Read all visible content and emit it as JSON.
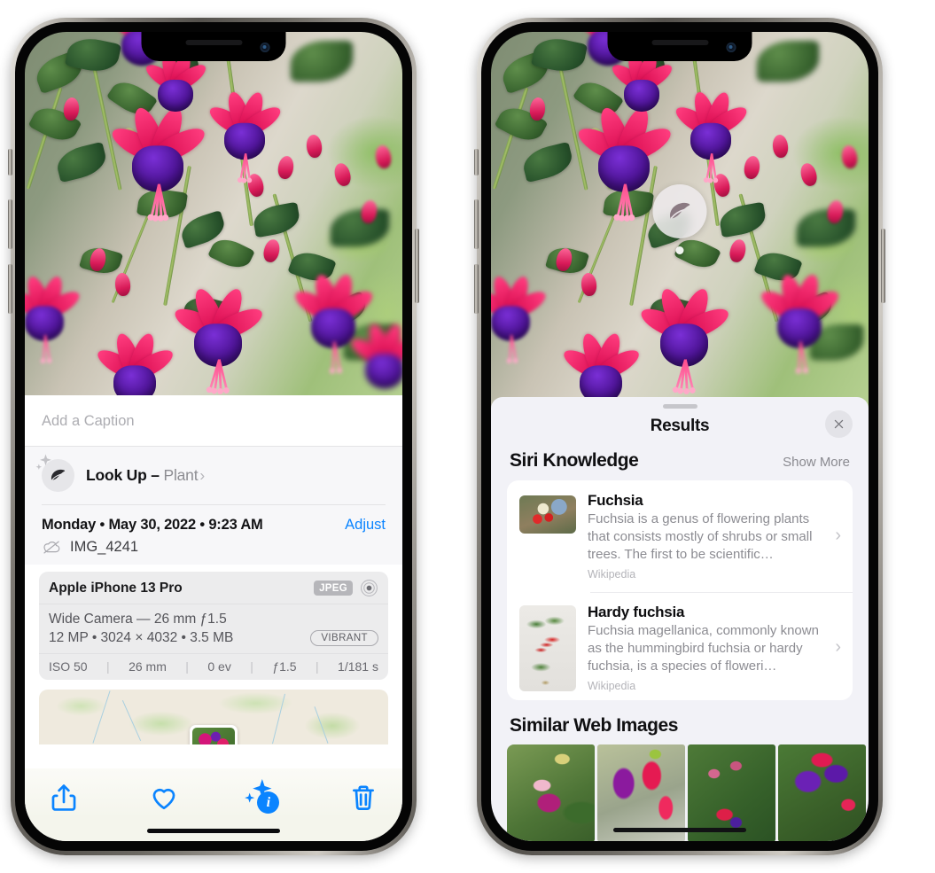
{
  "left_phone": {
    "caption_placeholder": "Add a Caption",
    "lookup": {
      "label": "Look Up",
      "separator": "–",
      "kind": "Plant",
      "chevron": "›",
      "icon": "leaf-icon"
    },
    "metadata": {
      "date": "Monday • May 30, 2022 • 9:23 AM",
      "adjust_label": "Adjust",
      "filename": "IMG_4241",
      "cloud_icon": "cloud-slash-icon"
    },
    "exif": {
      "device": "Apple iPhone 13 Pro",
      "format_badge": "JPEG",
      "hdr_icon": "hdr-icon",
      "lens": "Wide Camera — 26 mm ƒ1.5",
      "dimensions": "12 MP • 3024 × 4032 • 3.5 MB",
      "style_badge": "VIBRANT",
      "shot": {
        "iso": "ISO 50",
        "focal": "26 mm",
        "ev": "0 ev",
        "aperture": "ƒ1.5",
        "shutter": "1/181 s"
      }
    },
    "toolbar": {
      "share_label": "share-icon",
      "favorite_label": "heart-icon",
      "info_label": "info-sparkle-icon",
      "delete_label": "trash-icon",
      "accent_color": "#0a84ff"
    }
  },
  "right_phone": {
    "visual_lookup_badge": "leaf-icon",
    "sheet": {
      "title": "Results",
      "close_label": "close-icon"
    },
    "siri_knowledge": {
      "section_title": "Siri Knowledge",
      "show_more": "Show More",
      "cards": [
        {
          "title": "Fuchsia",
          "description": "Fuchsia is a genus of flowering plants that consists mostly of shrubs or small trees. The first to be scientific…",
          "source": "Wikipedia",
          "chevron": "›"
        },
        {
          "title": "Hardy fuchsia",
          "description": "Fuchsia magellanica, commonly known as the hummingbird fuchsia or hardy fuchsia, is a species of floweri…",
          "source": "Wikipedia",
          "chevron": "›"
        }
      ]
    },
    "similar_web_images": {
      "section_title": "Similar Web Images",
      "count": 4
    }
  }
}
